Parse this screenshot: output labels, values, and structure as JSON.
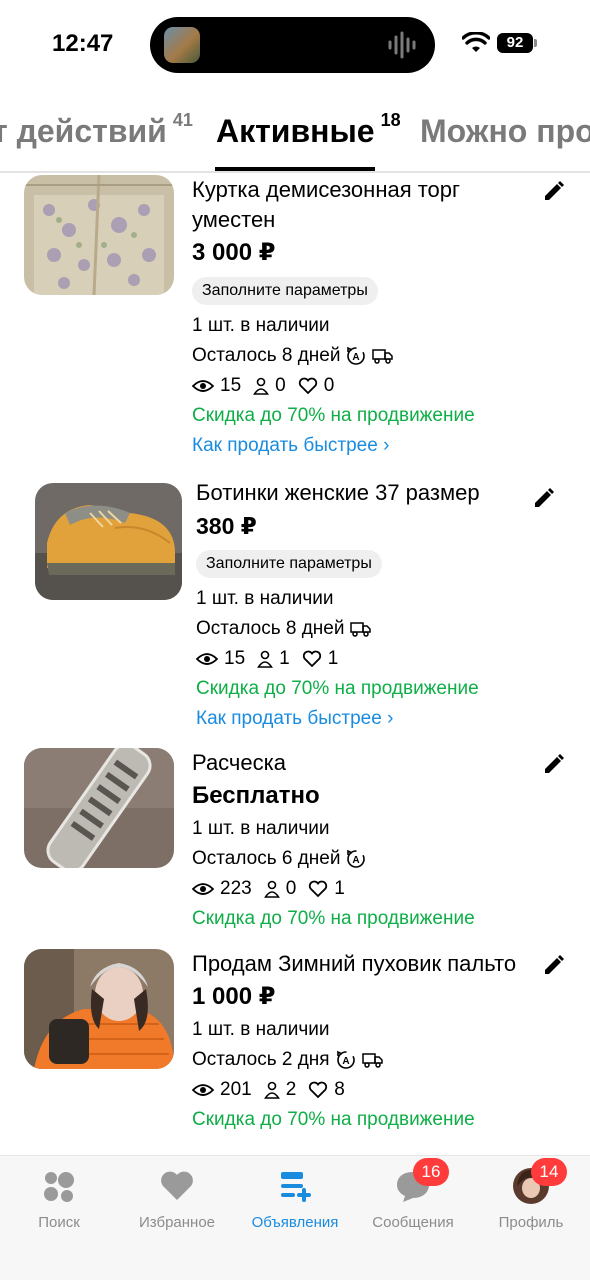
{
  "status_bar": {
    "time": "12:47",
    "battery": "92"
  },
  "tabs": [
    {
      "label": "т действий",
      "count": "41"
    },
    {
      "label": "Активные",
      "count": "18"
    },
    {
      "label": "Можно про",
      "count": ""
    }
  ],
  "listings": [
    {
      "title": "Куртка демисезонная торг уместен",
      "price": "3 000 ₽",
      "chip": "Заполните параметры",
      "stock": "1 шт. в наличии",
      "remaining": "Осталось 8 дней",
      "views": "15",
      "contacts": "0",
      "likes": "0",
      "promo": "Скидка до 70% на продвижение",
      "howto": "Как продать быстрее"
    },
    {
      "title": "Ботинки женские 37 размер",
      "price": "380 ₽",
      "chip": "Заполните параметры",
      "stock": "1 шт. в наличии",
      "remaining": "Осталось 8 дней",
      "views": "15",
      "contacts": "1",
      "likes": "1",
      "promo": "Скидка до 70% на продвижение",
      "howto": "Как продать быстрее"
    },
    {
      "title": "Расческа",
      "price": "Бесплатно",
      "stock": "1 шт. в наличии",
      "remaining": "Осталось 6 дней",
      "views": "223",
      "contacts": "0",
      "likes": "1",
      "promo": "Скидка до 70% на продвижение"
    },
    {
      "title": "Продам Зимний пуховик пальто",
      "price": "1 000 ₽",
      "stock": "1 шт. в наличии",
      "remaining": "Осталось 2 дня",
      "views": "201",
      "contacts": "2",
      "likes": "8",
      "promo": "Скидка до 70% на продвижение"
    }
  ],
  "bottom_nav": [
    {
      "label": "Поиск",
      "icon": "search-dots-icon",
      "badge": ""
    },
    {
      "label": "Избранное",
      "icon": "heart-icon",
      "badge": ""
    },
    {
      "label": "Объявления",
      "icon": "listings-add-icon",
      "badge": ""
    },
    {
      "label": "Сообщения",
      "icon": "chat-bubble-icon",
      "badge": "16"
    },
    {
      "label": "Профиль",
      "icon": "avatar-icon",
      "badge": "14"
    }
  ],
  "colors": {
    "accent_blue": "#1a8ce0",
    "promo_green": "#0fae47",
    "badge_red": "#ff3b3b"
  }
}
